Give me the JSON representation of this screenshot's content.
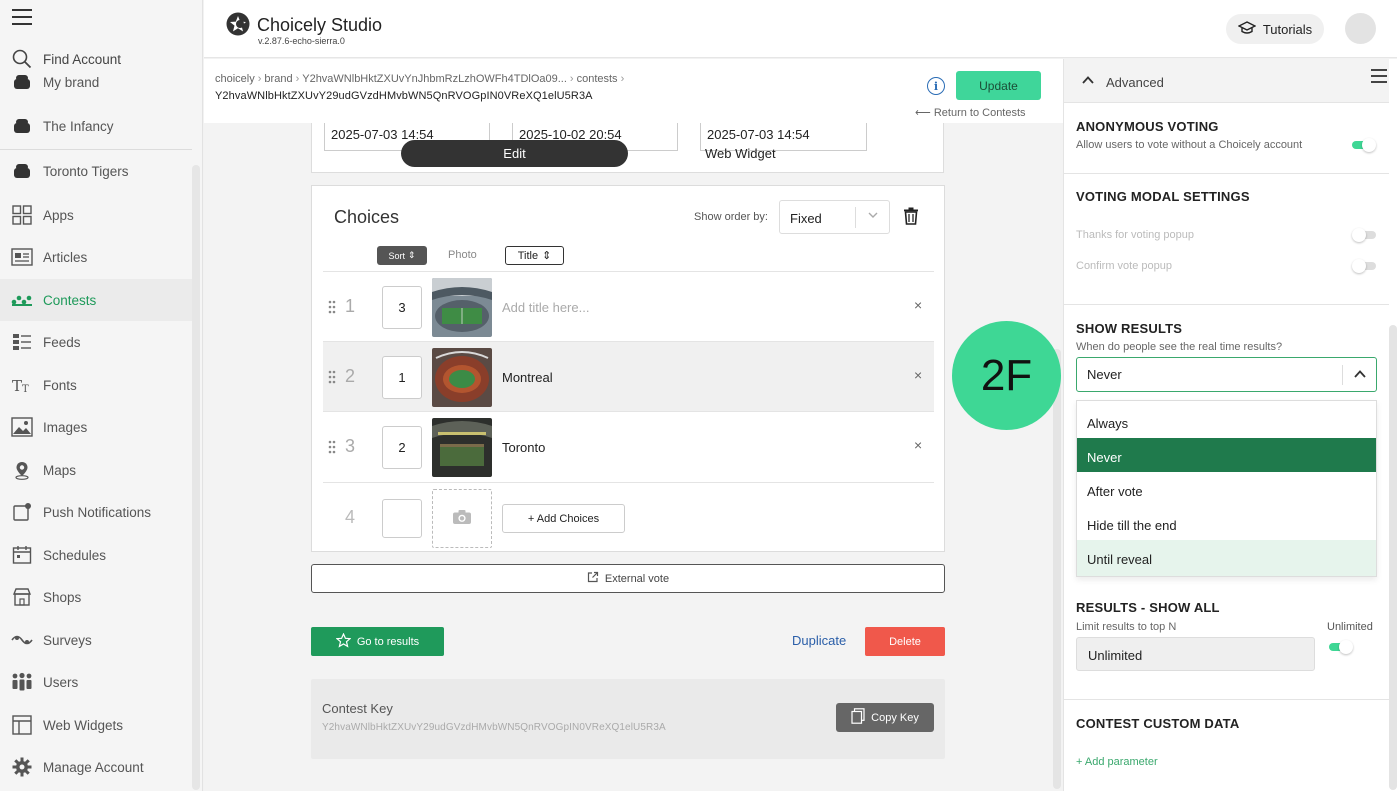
{
  "app": {
    "title": "Choicely Studio",
    "version": "v.2.87.6-echo-sierra.0",
    "tutorials_label": "Tutorials"
  },
  "sidebar": {
    "find_account": "Find Account",
    "items": [
      {
        "label": "My brand",
        "icon": "brand-icon"
      },
      {
        "label": "The Infancy",
        "icon": "brand-icon"
      },
      {
        "label": "Toronto Tigers",
        "icon": "brand-icon"
      },
      {
        "label": "Apps",
        "icon": "apps-icon"
      },
      {
        "label": "Articles",
        "icon": "articles-icon"
      },
      {
        "label": "Contests",
        "icon": "contests-icon"
      },
      {
        "label": "Feeds",
        "icon": "feeds-icon"
      },
      {
        "label": "Fonts",
        "icon": "fonts-icon"
      },
      {
        "label": "Images",
        "icon": "images-icon"
      },
      {
        "label": "Maps",
        "icon": "maps-icon"
      },
      {
        "label": "Push Notifications",
        "icon": "push-icon"
      },
      {
        "label": "Schedules",
        "icon": "schedules-icon"
      },
      {
        "label": "Shops",
        "icon": "shops-icon"
      },
      {
        "label": "Surveys",
        "icon": "surveys-icon"
      },
      {
        "label": "Users",
        "icon": "users-icon"
      },
      {
        "label": "Web Widgets",
        "icon": "web-widgets-icon"
      },
      {
        "label": "Manage Account",
        "icon": "gear-icon"
      }
    ],
    "active": "Contests"
  },
  "breadcrumb": {
    "items": [
      "choicely",
      "brand",
      "Y2hvaWNlbHktZXUvYnJhbmRzLzhOWFh4TDlOa09...",
      "contests"
    ],
    "id_line": "Y2hvaWNlbHktZXUvY29udGVzdHMvbWN5QnRVOGpIN0VReXQ1elU5R3A"
  },
  "toolbar": {
    "update_label": "Update",
    "return_label": "Return to Contests",
    "info_glyph": "i"
  },
  "dates": [
    "2025-07-03 14:54",
    "2025-10-02 20:54",
    "2025-07-03 14:54"
  ],
  "tabs": {
    "edit": "Edit",
    "web_widget": "Web Widget"
  },
  "choices": {
    "title": "Choices",
    "show_order_label": "Show order by:",
    "show_order_value": "Fixed",
    "sort_label": "Sort",
    "photo_label": "Photo",
    "title_col_label": "Title",
    "rows": [
      {
        "num": "1",
        "order": "3",
        "title": "Add title here...",
        "placeholder": true
      },
      {
        "num": "2",
        "order": "1",
        "title": "Montreal",
        "placeholder": false
      },
      {
        "num": "3",
        "order": "2",
        "title": "Toronto",
        "placeholder": false
      }
    ],
    "new_row_num": "4",
    "add_label": "+ Add Choices"
  },
  "actions": {
    "external_vote": "External vote",
    "go_to_results": "Go to results",
    "duplicate": "Duplicate",
    "delete": "Delete"
  },
  "contest_key": {
    "title": "Contest Key",
    "value": "Y2hvaWNlbHktZXUvY29udGVzdHMvbWN5QnRVOGpIN0VReXQ1elU5R3A",
    "copy_label": "Copy Key"
  },
  "step_badge": "2F",
  "advanced": {
    "title": "Advanced",
    "anonymous": {
      "title": "ANONYMOUS VOTING",
      "desc": "Allow users to vote without a Choicely account",
      "enabled": true
    },
    "modal": {
      "title": "VOTING MODAL SETTINGS",
      "thanks": "Thanks for voting popup",
      "confirm": "Confirm vote popup"
    },
    "show_results": {
      "title": "SHOW RESULTS",
      "desc": "When do people see the real time results?",
      "selected": "Never",
      "options": [
        "Always",
        "Never",
        "After vote",
        "Hide till the end",
        "Until reveal"
      ],
      "hovered": "Until reveal"
    },
    "results_all": {
      "title": "RESULTS - SHOW ALL",
      "desc": "Limit results to top N",
      "unlimited_label": "Unlimited",
      "input_value": "Unlimited"
    },
    "custom_data": {
      "title": "CONTEST CUSTOM DATA",
      "add_label": "+ Add parameter"
    }
  },
  "colors": {
    "accent": "#3ed795",
    "primary_green": "#1f9a5b",
    "selected_option": "#1f7a4c",
    "danger": "#f0584b",
    "link": "#2a5ea8"
  }
}
